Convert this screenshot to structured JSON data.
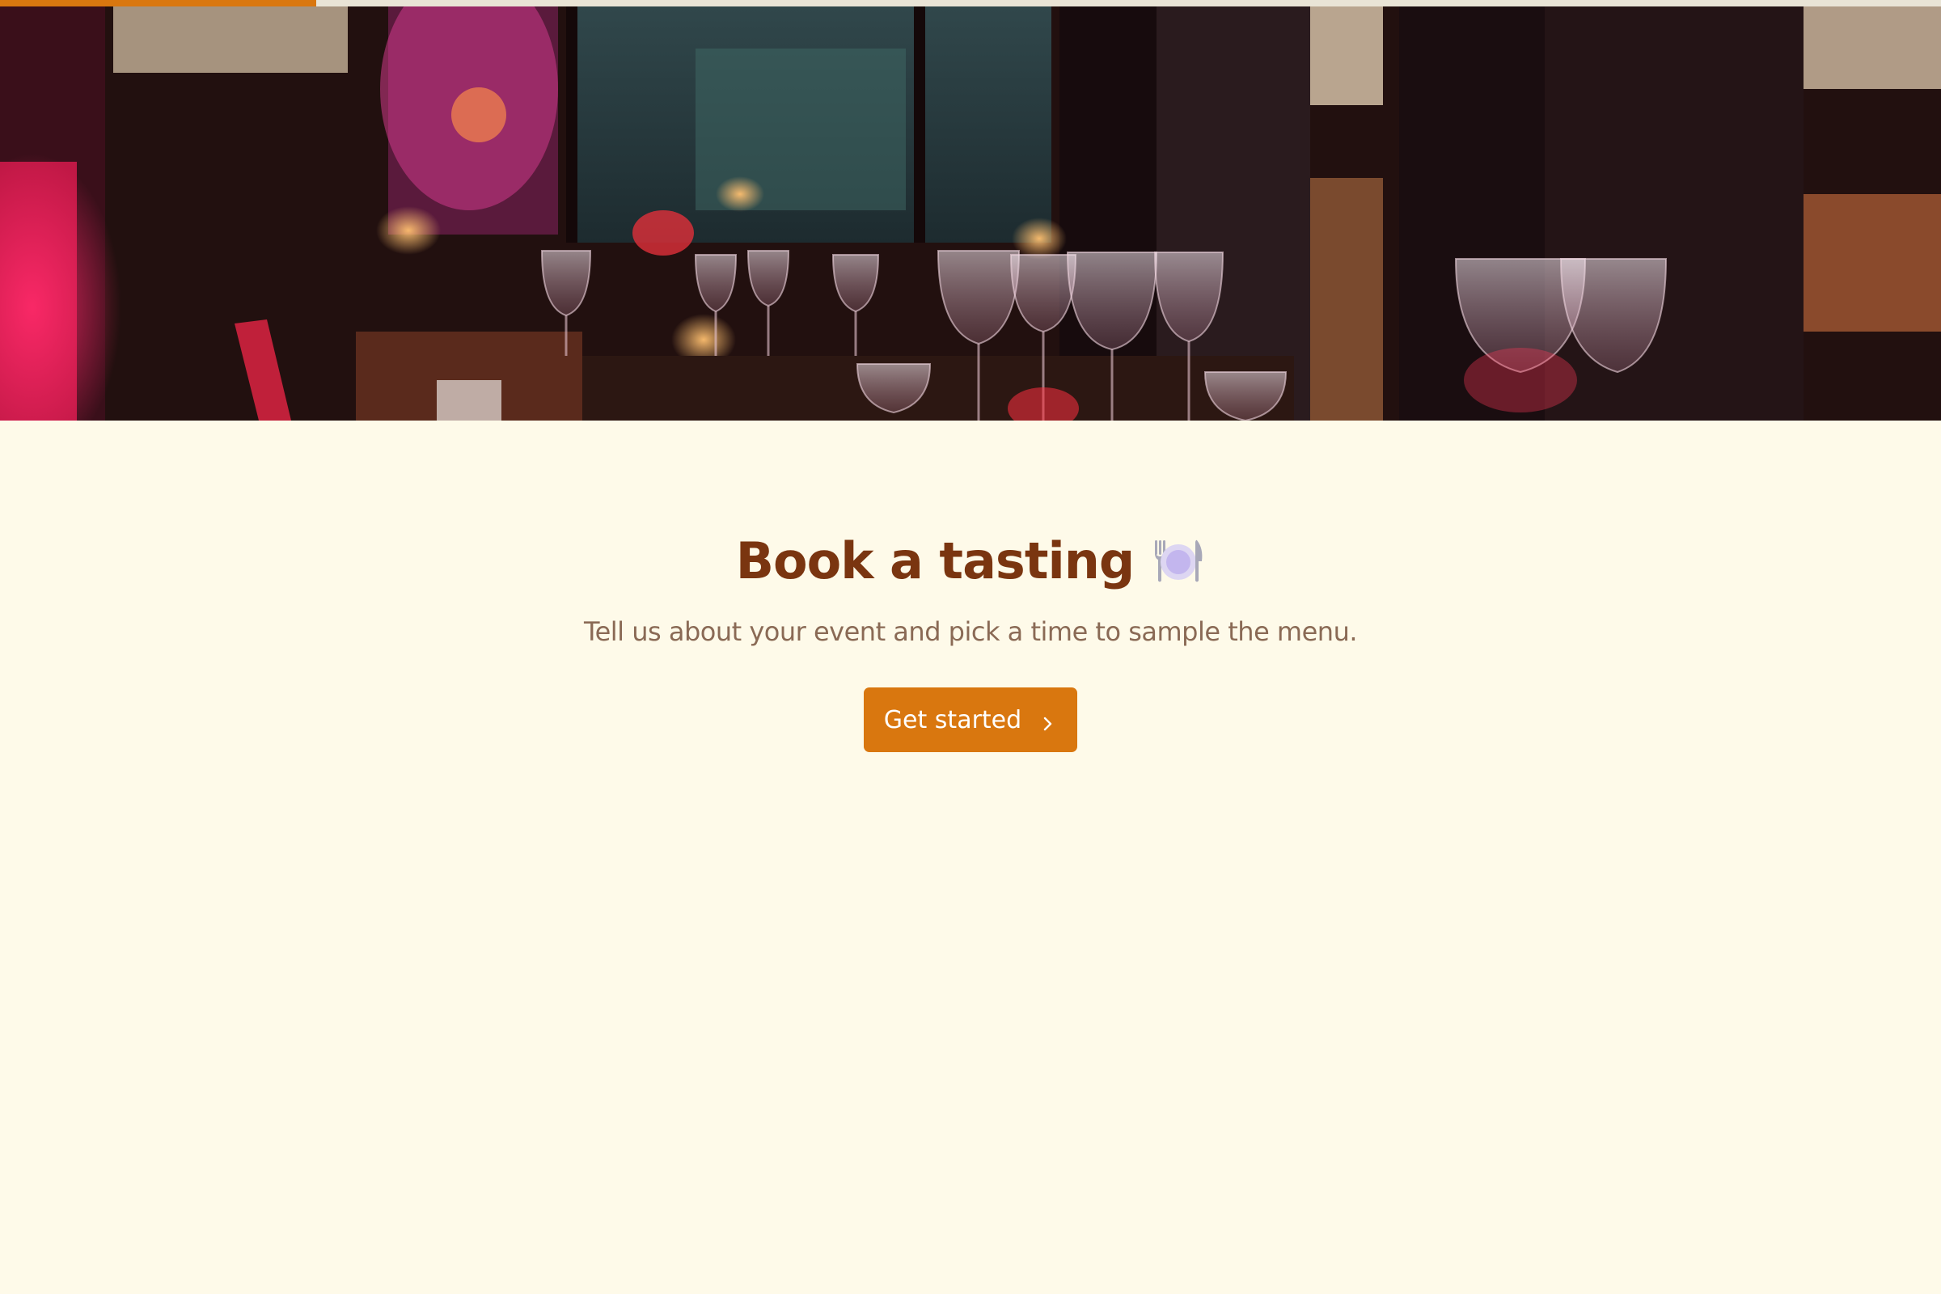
{
  "progress": {
    "value": 0.163,
    "color": "#d9770f"
  },
  "hero": {
    "image": "restaurant-table-wine-glasses-image"
  },
  "main": {
    "title": "Book a tasting",
    "title_icon": "plate-fork-knife-icon",
    "subtitle": "Tell us about your event and pick a time to sample the menu.",
    "cta_label": "Get started",
    "cta_icon": "chevron-right-icon"
  },
  "colors": {
    "background": "#fefae9",
    "accent": "#d9770f",
    "title": "#7a3510",
    "subtitle": "#8a6a55"
  }
}
